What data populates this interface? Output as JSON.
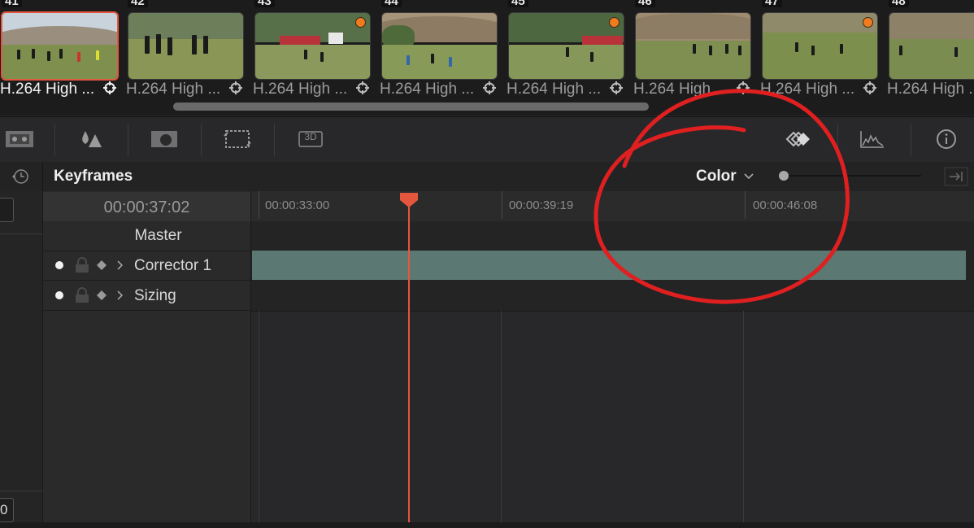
{
  "filmstrip": {
    "clips": [
      {
        "num": "41",
        "label": "H.264 High ...",
        "selected": true,
        "badge": false
      },
      {
        "num": "42",
        "label": "H.264 High ...",
        "selected": false,
        "badge": false
      },
      {
        "num": "43",
        "label": "H.264 High ...",
        "selected": false,
        "badge": true
      },
      {
        "num": "44",
        "label": "H.264 High ...",
        "selected": false,
        "badge": false
      },
      {
        "num": "45",
        "label": "H.264 High ...",
        "selected": false,
        "badge": true
      },
      {
        "num": "46",
        "label": "H.264 High ...",
        "selected": false,
        "badge": false
      },
      {
        "num": "47",
        "label": "H.264 High ...",
        "selected": false,
        "badge": true
      },
      {
        "num": "48",
        "label": "H.264 High ...",
        "selected": false,
        "badge": false
      }
    ]
  },
  "toolbar": {
    "tools": [
      "viewer-layout-icon",
      "color-drops-icon",
      "window-mask-icon",
      "transform-icon",
      "3d-icon",
      "keyframes-icon",
      "scopes-icon",
      "info-icon"
    ],
    "three_d_label": "3D"
  },
  "keyframes": {
    "title": "Keyframes",
    "mode": "Color",
    "timecode": "00:00:37:02",
    "ruler": [
      "00:00:33:00",
      "00:00:39:19",
      "00:00:46:08"
    ],
    "rows": [
      {
        "label": "Master"
      },
      {
        "label": "Corrector 1"
      },
      {
        "label": "Sizing"
      }
    ]
  },
  "gutter": {
    "bottom_label": "0"
  },
  "colors": {
    "playhead": "#e5563f",
    "corrector_bar": "#5b7872",
    "annotation": "#e02020"
  }
}
